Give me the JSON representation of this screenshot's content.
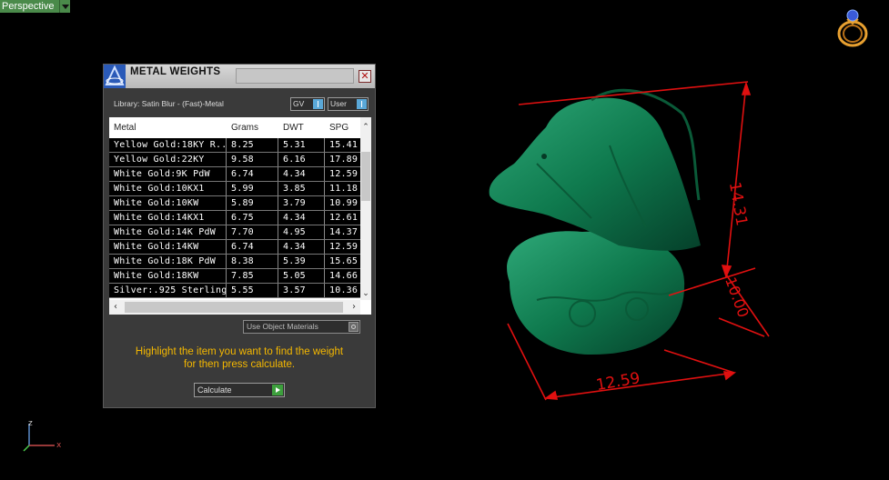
{
  "viewport": {
    "label": "Perspective"
  },
  "panel": {
    "title": "METAL WEIGHTS",
    "close_symbol": "✕",
    "library_label": "Library: Satin Blur - (Fast)-Metal",
    "gv_combo": "GV",
    "user_combo": "User",
    "columns": [
      "Metal",
      "Grams",
      "DWT",
      "SPG"
    ],
    "rows": [
      [
        "Yellow Gold:18KY R...",
        "8.25",
        "5.31",
        "15.41"
      ],
      [
        "Yellow Gold:22KY",
        "9.58",
        "6.16",
        "17.89"
      ],
      [
        "White Gold:9K PdW",
        "6.74",
        "4.34",
        "12.59"
      ],
      [
        "White Gold:10KX1",
        "5.99",
        "3.85",
        "11.18"
      ],
      [
        "White Gold:10KW",
        "5.89",
        "3.79",
        "10.99"
      ],
      [
        "White Gold:14KX1",
        "6.75",
        "4.34",
        "12.61"
      ],
      [
        "White Gold:14K PdW",
        "7.70",
        "4.95",
        "14.37"
      ],
      [
        "White Gold:14KW",
        "6.74",
        "4.34",
        "12.59"
      ],
      [
        "White Gold:18K PdW",
        "8.38",
        "5.39",
        "15.65"
      ],
      [
        "White Gold:18KW",
        "7.85",
        "5.05",
        "14.66"
      ],
      [
        "Silver:.925 Sterling",
        "5.55",
        "3.57",
        "10.36"
      ]
    ],
    "use_object_materials": "Use Object Materials",
    "instruction_line1": "Highlight the item you want to find the weight",
    "instruction_line2": "for then press calculate.",
    "calculate_label": "Calculate"
  },
  "dimensions": {
    "height": "14.31",
    "depth": "10.00",
    "width": "12.59"
  },
  "gizmo": {
    "z": "z",
    "x": "x"
  },
  "colors": {
    "model": "#0f7a4e",
    "dimension": "#e01010",
    "accent": "#f5b800",
    "viewport_tab": "#4a8a4a"
  }
}
